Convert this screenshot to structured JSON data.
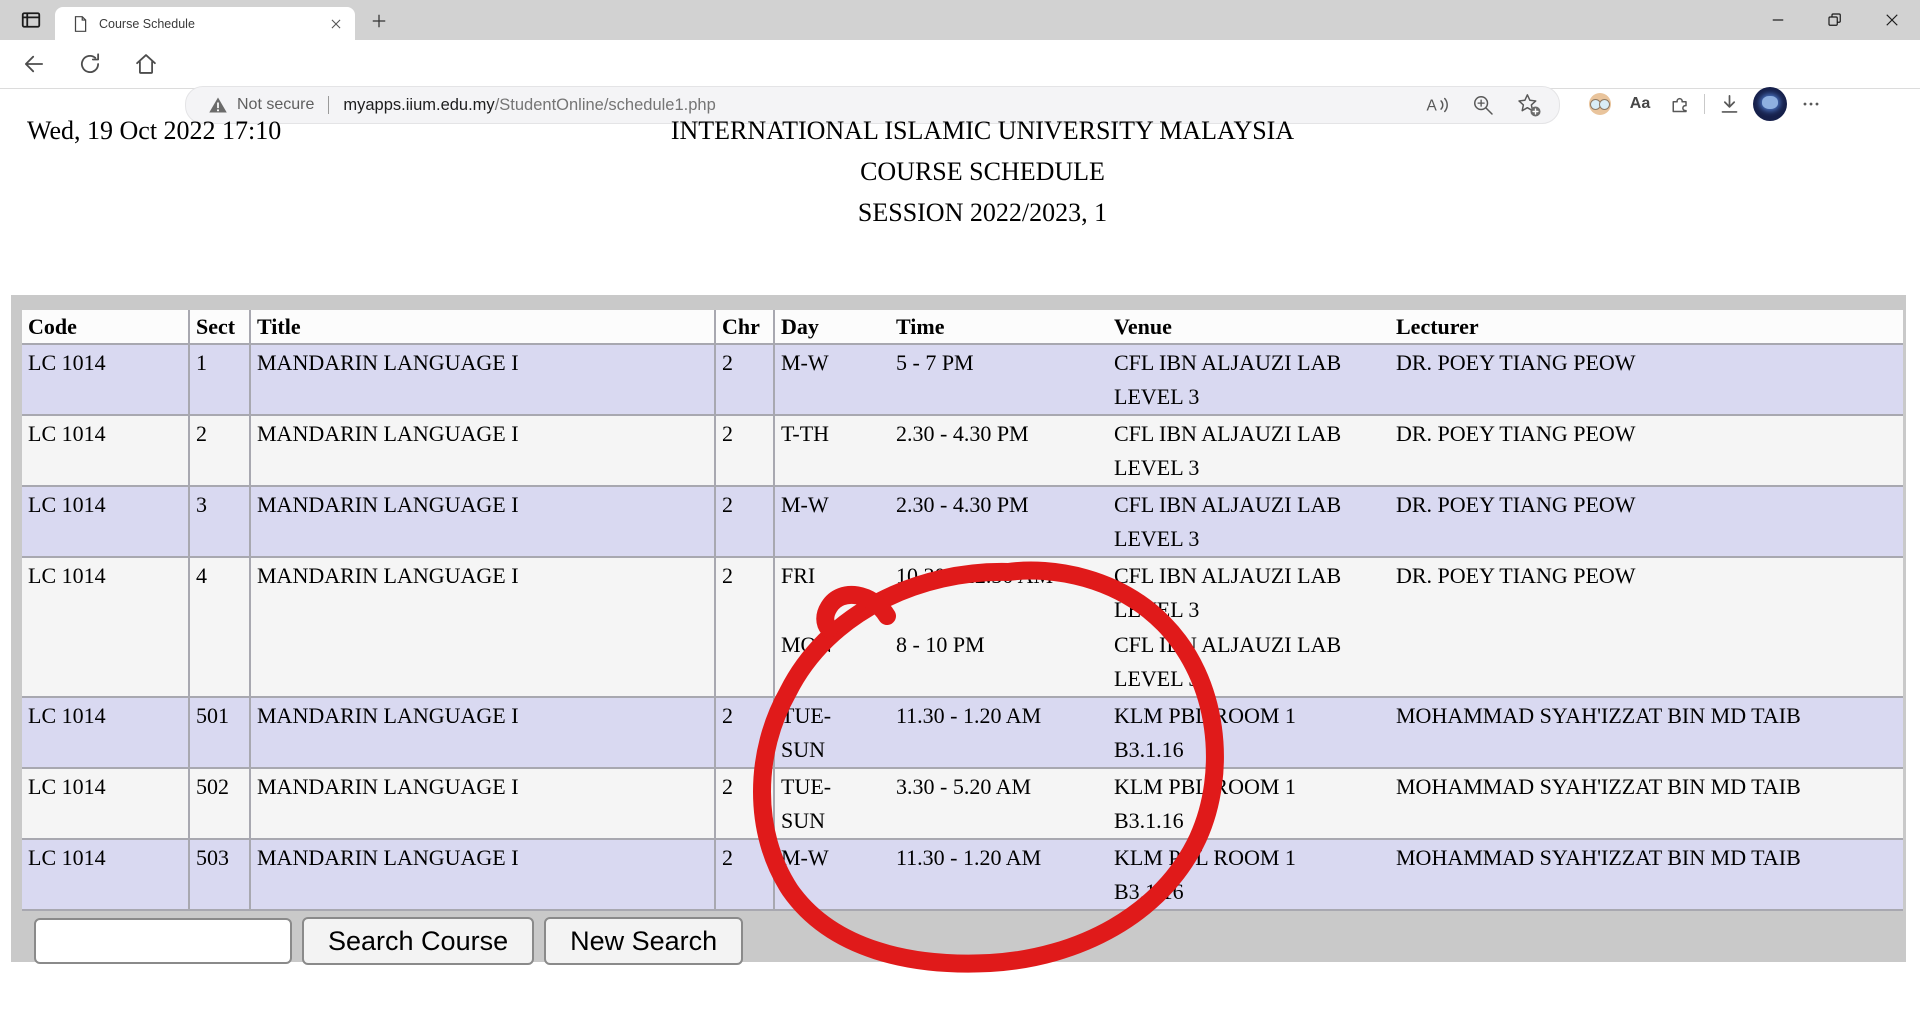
{
  "browser": {
    "tab": {
      "title": "Course Schedule"
    },
    "new_tab_glyph": "+",
    "address": {
      "security_label": "Not secure",
      "url_host": "myapps.iium.edu.my",
      "url_path": "/StudentOnline/schedule1.php"
    },
    "aa_glyph": "Aa"
  },
  "page": {
    "timestamp": "Wed, 19 Oct 2022 17:10",
    "title_lines": [
      "INTERNATIONAL ISLAMIC UNIVERSITY MALAYSIA",
      "COURSE SCHEDULE",
      "SESSION 2022/2023, 1"
    ]
  },
  "schedule": {
    "columns": [
      "Code",
      "Sect",
      "Title",
      "Chr",
      "Day",
      "Time",
      "Venue",
      "Lecturer"
    ],
    "rows": [
      {
        "code": "LC 1014",
        "sect": "1",
        "title": "MANDARIN LANGUAGE I",
        "chr": "2",
        "lecturer": "DR. POEY TIANG PEOW",
        "sessions": [
          {
            "day_lines": [
              "M-W"
            ],
            "time": "5 - 7 PM",
            "venue_lines": [
              "CFL IBN ALJAUZI LAB",
              "LEVEL 3"
            ]
          }
        ]
      },
      {
        "code": "LC 1014",
        "sect": "2",
        "title": "MANDARIN LANGUAGE I",
        "chr": "2",
        "lecturer": "DR. POEY TIANG PEOW",
        "sessions": [
          {
            "day_lines": [
              "T-TH"
            ],
            "time": "2.30 - 4.30 PM",
            "venue_lines": [
              "CFL IBN ALJAUZI LAB",
              "LEVEL 3"
            ]
          }
        ]
      },
      {
        "code": "LC 1014",
        "sect": "3",
        "title": "MANDARIN LANGUAGE I",
        "chr": "2",
        "lecturer": "DR. POEY TIANG PEOW",
        "sessions": [
          {
            "day_lines": [
              "M-W"
            ],
            "time": "2.30 - 4.30 PM",
            "venue_lines": [
              "CFL IBN ALJAUZI LAB",
              "LEVEL 3"
            ]
          }
        ]
      },
      {
        "code": "LC 1014",
        "sect": "4",
        "title": "MANDARIN LANGUAGE I",
        "chr": "2",
        "lecturer": "DR. POEY TIANG PEOW",
        "sessions": [
          {
            "day_lines": [
              "FRI"
            ],
            "time": "10.30 - 12.30 AM",
            "venue_lines": [
              "CFL IBN ALJAUZI LAB",
              "LEVEL 3"
            ]
          },
          {
            "day_lines": [
              "MON"
            ],
            "time": "8 - 10 PM",
            "venue_lines": [
              "CFL IBN ALJAUZI LAB",
              "LEVEL 3"
            ]
          }
        ]
      },
      {
        "code": "LC 1014",
        "sect": "501",
        "title": "MANDARIN LANGUAGE I",
        "chr": "2",
        "lecturer": "MOHAMMAD SYAH'IZZAT BIN MD TAIB",
        "sessions": [
          {
            "day_lines": [
              "TUE-",
              "SUN"
            ],
            "time": "11.30 - 1.20 AM",
            "venue_lines": [
              "KLM PBL ROOM 1",
              "B3.1.16"
            ]
          }
        ]
      },
      {
        "code": "LC 1014",
        "sect": "502",
        "title": "MANDARIN LANGUAGE I",
        "chr": "2",
        "lecturer": "MOHAMMAD SYAH'IZZAT BIN MD TAIB",
        "sessions": [
          {
            "day_lines": [
              "TUE-",
              "SUN"
            ],
            "time": "3.30 - 5.20 AM",
            "venue_lines": [
              "KLM PBL ROOM 1",
              "B3.1.16"
            ]
          }
        ]
      },
      {
        "code": "LC 1014",
        "sect": "503",
        "title": "MANDARIN LANGUAGE I",
        "chr": "2",
        "lecturer": "MOHAMMAD SYAH'IZZAT BIN MD TAIB",
        "sessions": [
          {
            "day_lines": [
              "M-W"
            ],
            "time": "11.30 - 1.20 AM",
            "venue_lines": [
              "KLM PBL ROOM 1",
              "B3.1.16"
            ]
          }
        ]
      }
    ]
  },
  "form": {
    "search_value": "",
    "search_button_label": "Search Course",
    "new_search_button_label": "New Search"
  },
  "annotation": {
    "circle_color": "#e01a1a"
  },
  "colors": {
    "page-bg": "#ffffff",
    "tabstrip-bg": "#d2d2d2",
    "panel-bg": "#c9c9c9",
    "row-bg": "#f5f5f5",
    "row-alt-bg": "#d9d9f1",
    "header-row-bg": "#fcfcfc",
    "grid-line": "#a8a8b0",
    "profile-bg": "#16204a"
  }
}
